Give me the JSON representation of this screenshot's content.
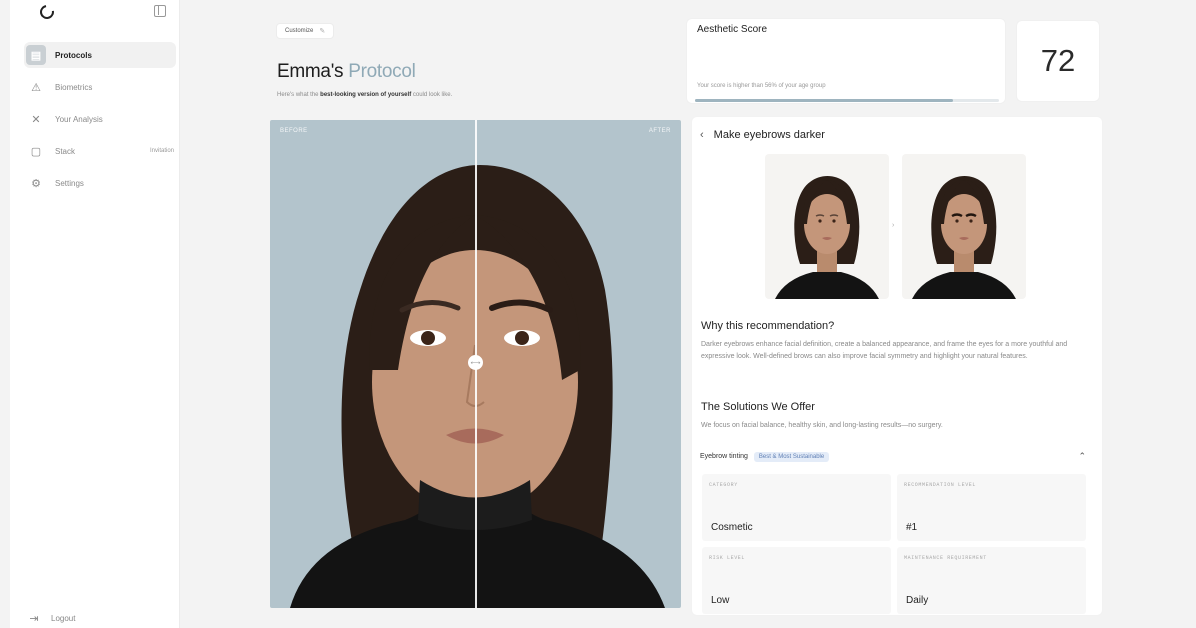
{
  "sidebar": {
    "items": [
      {
        "label": "Protocols",
        "icon": "grid-icon",
        "active": true,
        "badge": ""
      },
      {
        "label": "Biometrics",
        "icon": "warning-icon",
        "active": false,
        "badge": ""
      },
      {
        "label": "Your Analysis",
        "icon": "scissors-icon",
        "active": false,
        "badge": ""
      },
      {
        "label": "Stack",
        "icon": "calendar-icon",
        "active": false,
        "badge": "Invitation"
      },
      {
        "label": "Settings",
        "icon": "gear-icon",
        "active": false,
        "badge": ""
      }
    ],
    "logout_label": "Logout"
  },
  "header": {
    "breadcrumb": "Customize",
    "title_main": "Emma's",
    "title_accent": "Protocol",
    "subtitle_prefix": "Here's what the ",
    "subtitle_bold": "best-looking version of yourself",
    "subtitle_suffix": " could look like."
  },
  "compare": {
    "before_label": "BEFORE",
    "after_label": "AFTER",
    "handle_glyph": "⟷"
  },
  "score": {
    "label": "Aesthetic Score",
    "value": "72",
    "description": "Your score is higher than 56% of your age group",
    "progress_fraction": 0.85
  },
  "recommendation": {
    "title": "Make eyebrows darker",
    "why_title": "Why this recommendation?",
    "why_body": "Darker eyebrows enhance facial definition, create a balanced appearance, and frame the eyes for a more youthful and expressive look. Well-defined brows can also improve facial symmetry and highlight your natural features.",
    "solutions_title": "The Solutions We Offer",
    "solutions_body": "We focus on facial balance, healthy skin, and long-lasting results—no surgery.",
    "solution": {
      "name": "Eyebrow tinting",
      "badge": "Best & Most Sustainable"
    },
    "details": [
      {
        "label": "CATEGORY",
        "value": "Cosmetic"
      },
      {
        "label": "RECOMMENDATION LEVEL",
        "value": "#1"
      },
      {
        "label": "RISK LEVEL",
        "value": "Low"
      },
      {
        "label": "MAINTENANCE REQUIREMENT",
        "value": "Daily"
      }
    ]
  },
  "colors": {
    "accent": "#8fa9b6",
    "photo_bg": "#b3c4cc",
    "badge_bg": "#e4ecf8",
    "badge_text": "#5f7fb4"
  }
}
